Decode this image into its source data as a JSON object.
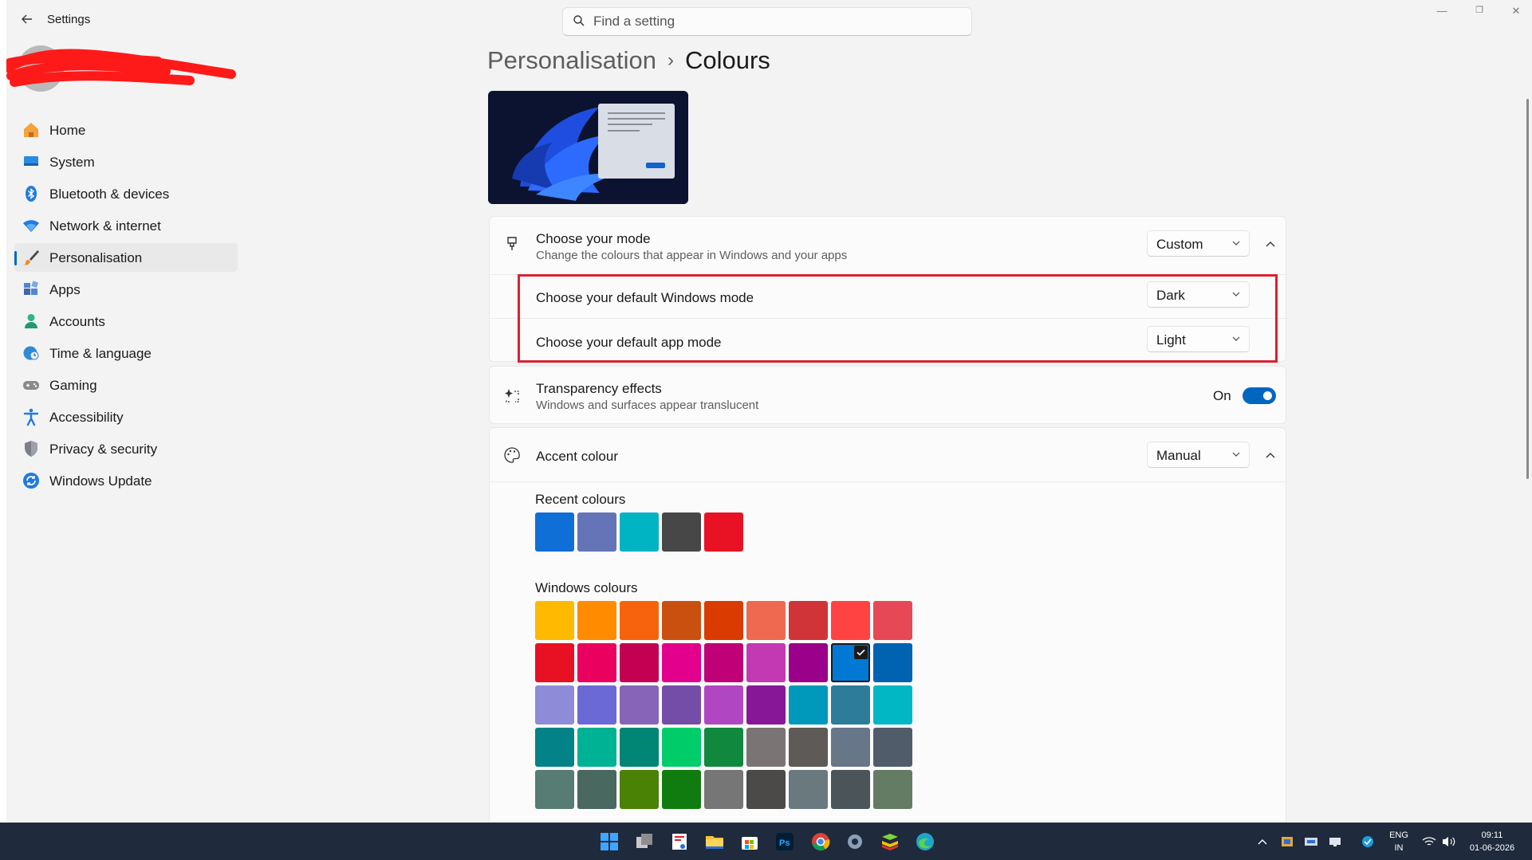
{
  "window": {
    "title": "Settings"
  },
  "search": {
    "placeholder": "Find a setting"
  },
  "sidebar": {
    "items": [
      {
        "label": "Home",
        "icon": "home-icon"
      },
      {
        "label": "System",
        "icon": "system-icon"
      },
      {
        "label": "Bluetooth & devices",
        "icon": "bluetooth-icon"
      },
      {
        "label": "Network & internet",
        "icon": "wifi-icon"
      },
      {
        "label": "Personalisation",
        "icon": "brush-icon",
        "active": true
      },
      {
        "label": "Apps",
        "icon": "apps-icon"
      },
      {
        "label": "Accounts",
        "icon": "person-icon"
      },
      {
        "label": "Time & language",
        "icon": "globe-clock-icon"
      },
      {
        "label": "Gaming",
        "icon": "gamepad-icon"
      },
      {
        "label": "Accessibility",
        "icon": "accessibility-icon"
      },
      {
        "label": "Privacy & security",
        "icon": "shield-icon"
      },
      {
        "label": "Windows Update",
        "icon": "update-icon"
      }
    ]
  },
  "breadcrumb": {
    "parent": "Personalisation",
    "separator": "›",
    "current": "Colours"
  },
  "mode": {
    "title": "Choose your mode",
    "subtitle": "Change the colours that appear in Windows and your apps",
    "value": "Custom",
    "windows_mode_label": "Choose your default Windows mode",
    "windows_mode_value": "Dark",
    "app_mode_label": "Choose your default app mode",
    "app_mode_value": "Light"
  },
  "transparency": {
    "title": "Transparency effects",
    "subtitle": "Windows and surfaces appear translucent",
    "state": "On"
  },
  "accent": {
    "title": "Accent colour",
    "value": "Manual",
    "recent_label": "Recent colours",
    "recent": [
      "#0f6fd6",
      "#6574b7",
      "#00b4c3",
      "#474747",
      "#e81224"
    ],
    "windows_label": "Windows colours",
    "selected": "#0078d4",
    "windows": [
      [
        "#ffb900",
        "#ff8c00",
        "#f7630c",
        "#ca5010",
        "#da3b01",
        "#ef6950",
        "#d13438",
        "#ff4343",
        "#e74856"
      ],
      [
        "#e81123",
        "#ea005e",
        "#c30052",
        "#e3008c",
        "#bf0077",
        "#c239b3",
        "#9a0089",
        "#0078d4",
        "#0063b1"
      ],
      [
        "#8e8cd8",
        "#6b69d6",
        "#8764b8",
        "#744da9",
        "#b146c2",
        "#881798",
        "#0099bc",
        "#2d7d9a",
        "#00b7c3"
      ],
      [
        "#038387",
        "#00b294",
        "#018574",
        "#00cc6a",
        "#10893e",
        "#7a7574",
        "#5d5a58",
        "#68768a",
        "#515c6b"
      ],
      [
        "#567c73",
        "#486860",
        "#498205",
        "#107c10",
        "#767676",
        "#4c4a48",
        "#69797e",
        "#4a5459",
        "#647c64"
      ]
    ]
  },
  "taskbar": {
    "language": "ENG",
    "region": "IN",
    "time": "09:11",
    "date": "01-06-2026",
    "apps": [
      "start-icon",
      "task-view-icon",
      "snipping-tool-icon",
      "file-explorer-icon",
      "store-icon",
      "photoshop-icon",
      "chrome-icon",
      "settings-icon",
      "bluestacks-icon",
      "edge-icon"
    ]
  }
}
